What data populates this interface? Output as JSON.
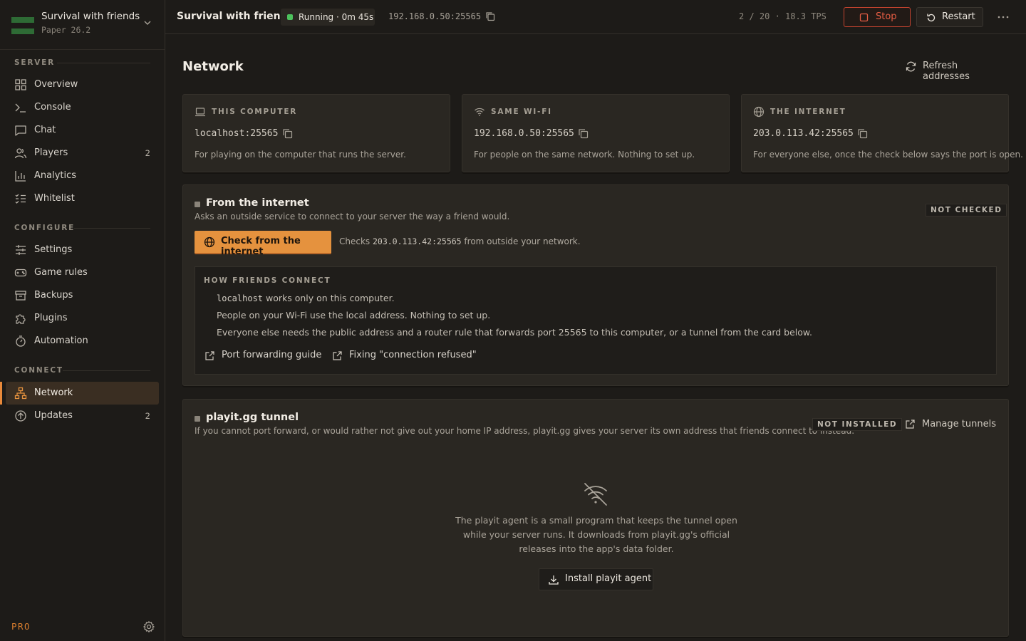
{
  "server": {
    "name": "Survival with friends",
    "version": "Paper 26.2"
  },
  "sidebar": {
    "sections": {
      "server": "SERVER",
      "configure": "CONFIGURE",
      "connect": "CONNECT"
    },
    "items": {
      "overview": {
        "label": "Overview"
      },
      "console": {
        "label": "Console"
      },
      "chat": {
        "label": "Chat"
      },
      "players": {
        "label": "Players",
        "count": "2"
      },
      "analytics": {
        "label": "Analytics"
      },
      "whitelist": {
        "label": "Whitelist"
      },
      "settings": {
        "label": "Settings"
      },
      "gamerules": {
        "label": "Game rules"
      },
      "backups": {
        "label": "Backups"
      },
      "plugins": {
        "label": "Plugins"
      },
      "automation": {
        "label": "Automation"
      },
      "network": {
        "label": "Network",
        "active": true
      },
      "updates": {
        "label": "Updates",
        "count": "2"
      }
    },
    "plan_label": "PRO"
  },
  "topbar": {
    "title": "Survival with friends",
    "status": "Running · 0m 45s",
    "address": "192.168.0.50:25565",
    "stats": "2 / 20 · 18.3 TPS",
    "stop_label": "Stop",
    "restart_label": "Restart"
  },
  "main": {
    "title": "Network",
    "refresh_label": "Refresh addresses",
    "cards": [
      {
        "heading": "THIS COMPUTER",
        "address": "localhost:25565",
        "desc": "For playing on the computer that runs the server.",
        "icon": "laptop-icon"
      },
      {
        "heading": "SAME WI-FI",
        "address": "192.168.0.50:25565",
        "desc": "For people on the same network. Nothing to set up.",
        "icon": "wifi-icon"
      },
      {
        "heading": "THE INTERNET",
        "address": "203.0.113.42:25565",
        "desc": "For everyone else, once the check below says the port is open.",
        "icon": "globe-icon"
      }
    ],
    "internet_check": {
      "title": "From the internet",
      "subtitle": "Asks an outside service to connect to your server the way a friend would.",
      "badge": "NOT CHECKED",
      "button_label": "Check from the internet",
      "note_prefix": "Checks ",
      "note_address": "203.0.113.42:25565",
      "note_suffix": " from outside your network.",
      "how": {
        "heading": "HOW FRIENDS CONNECT",
        "line1_code": "localhost",
        "line1_rest": " works only on this computer.",
        "line2": "People on your Wi-Fi use the local address. Nothing to set up.",
        "line3": "Everyone else needs the public address and a router rule that forwards port 25565 to this computer, or a tunnel from the card below.",
        "link1": "Port forwarding guide",
        "link2": "Fixing \"connection refused\""
      }
    },
    "tunnel": {
      "title": "playit.gg tunnel",
      "subtitle": "If you cannot port forward, or would rather not give out your home IP address, playit.gg gives your server its own address that friends connect to instead.",
      "badge": "NOT INSTALLED",
      "manage_label": "Manage tunnels",
      "empty_text": "The playit agent is a small program that keeps the tunnel open while your server runs. It downloads from playit.gg's official releases into the app's data folder.",
      "install_label": "Install playit agent"
    }
  },
  "colors": {
    "accent": "#e5923e",
    "running": "#4cc25c",
    "danger": "#c2432f",
    "brand": "#2e6b35"
  }
}
